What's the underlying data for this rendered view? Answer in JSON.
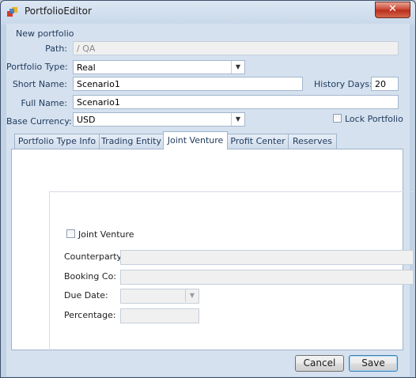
{
  "window": {
    "title": "PortfolioEditor",
    "close_glyph": "✕"
  },
  "header": {
    "title": "New portfolio"
  },
  "form": {
    "path_label": "Path:",
    "path_value": "/ QA",
    "portfolio_type_label": "Portfolio Type:",
    "portfolio_type_value": "Real",
    "short_name_label": "Short Name:",
    "short_name_value": "Scenario1",
    "history_days_label": "History Days:",
    "history_days_value": "20",
    "full_name_label": "Full Name:",
    "full_name_value": "Scenario1",
    "base_currency_label": "Base Currency:",
    "base_currency_value": "USD",
    "lock_portfolio_label": "Lock Portfolio"
  },
  "tabs": [
    {
      "label": "Portfolio Type Info"
    },
    {
      "label": "Trading Entity"
    },
    {
      "label": "Joint Venture"
    },
    {
      "label": "Profit Center"
    },
    {
      "label": "Reserves"
    }
  ],
  "active_tab": "Joint Venture",
  "joint_venture": {
    "checkbox_label": "Joint Venture",
    "counterparty_label": "Counterparty:",
    "booking_co_label": "Booking Co:",
    "due_date_label": "Due Date:",
    "percentage_label": "Percentage:"
  },
  "buttons": {
    "cancel": "Cancel",
    "save": "Save"
  },
  "colors": {
    "titlebar": "#dce7f3",
    "client": "#d5e1ef",
    "label_text": "#1e395b",
    "close_button": "#c7432f"
  },
  "icons": [
    "app-icon",
    "close-icon",
    "dropdown-arrow-icon"
  ]
}
